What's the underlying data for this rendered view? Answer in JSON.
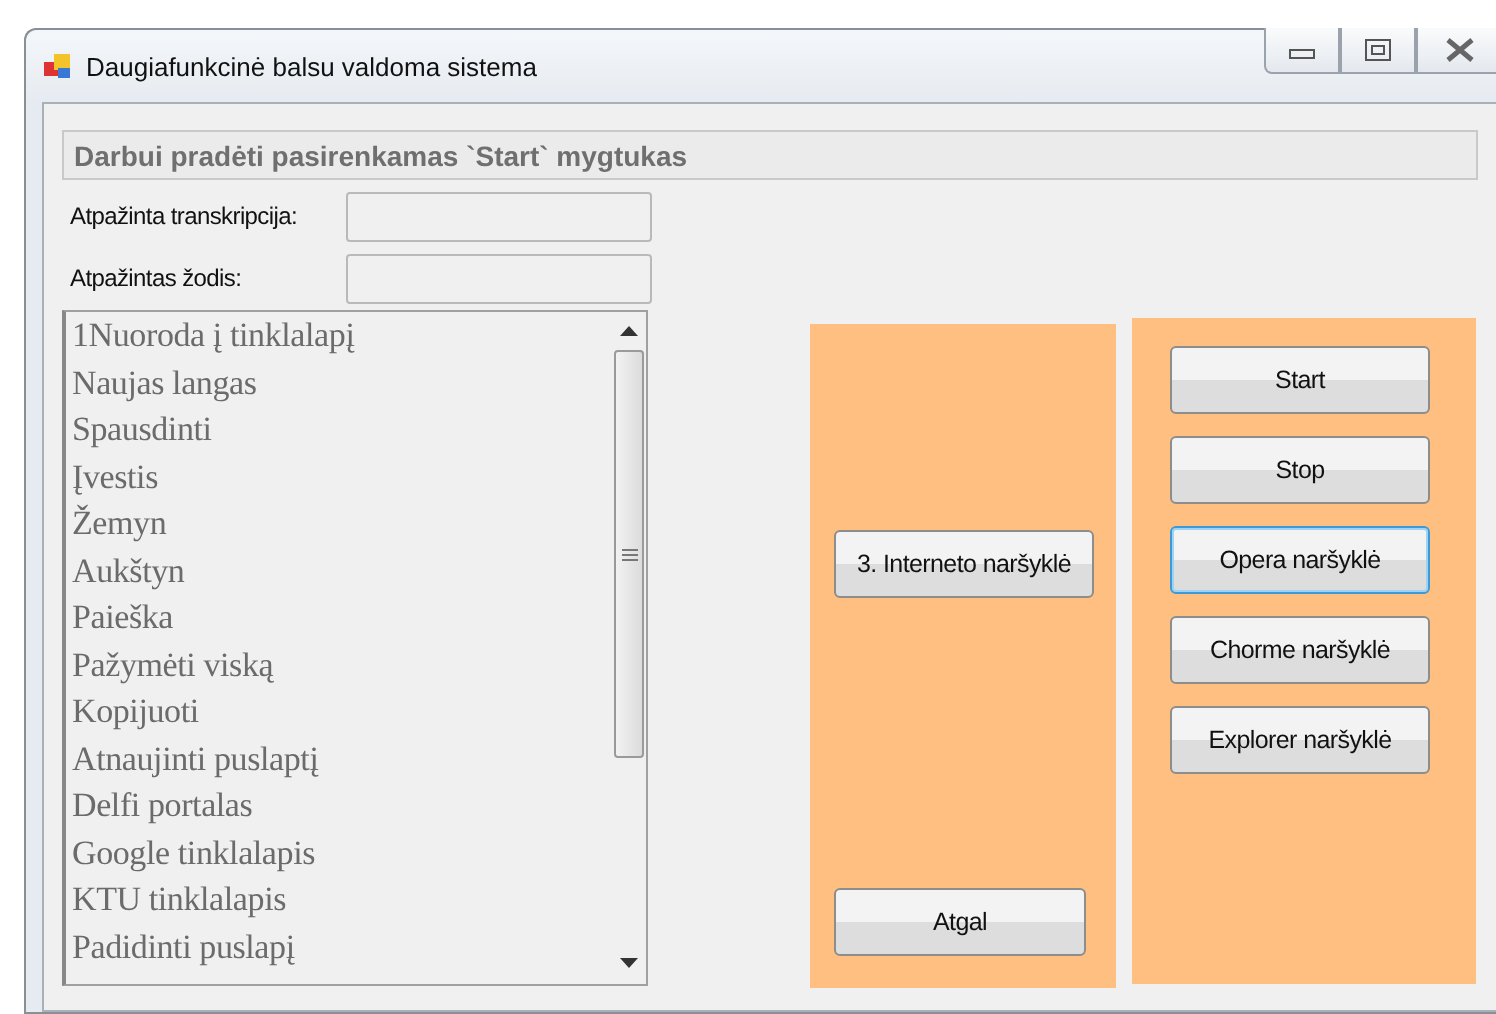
{
  "window": {
    "title": "Daugiafunkcinė balsu valdoma sistema"
  },
  "banner": "Darbui pradėti pasirenkamas `Start` mygtukas",
  "fields": [
    {
      "label": "Atpažinta transkripcija:"
    },
    {
      "label": "Atpažintas žodis:"
    }
  ],
  "commands": [
    "1Nuoroda į tinklalapį",
    "Naujas langas",
    "Spausdinti",
    "Įvestis",
    "Žemyn",
    "Aukštyn",
    "Paieška",
    "Pažymėti viską",
    "Kopijuoti",
    "Atnaujinti puslaptį",
    "Delfi portalas",
    "Google tinklalapis",
    "KTU tinklalapis",
    "Padidinti puslapį"
  ],
  "left_panel": {
    "buttons": [
      {
        "label": "3. Interneto naršyklė",
        "focused": false
      },
      {
        "label": "Atgal",
        "focused": false
      }
    ]
  },
  "right_panel": {
    "buttons": [
      {
        "label": "Start",
        "focused": false
      },
      {
        "label": "Stop",
        "focused": false
      },
      {
        "label": "Opera naršyklė",
        "focused": true
      },
      {
        "label": "Chorme naršyklė",
        "focused": false
      },
      {
        "label": "Explorer naršyklė",
        "focused": false
      }
    ]
  }
}
